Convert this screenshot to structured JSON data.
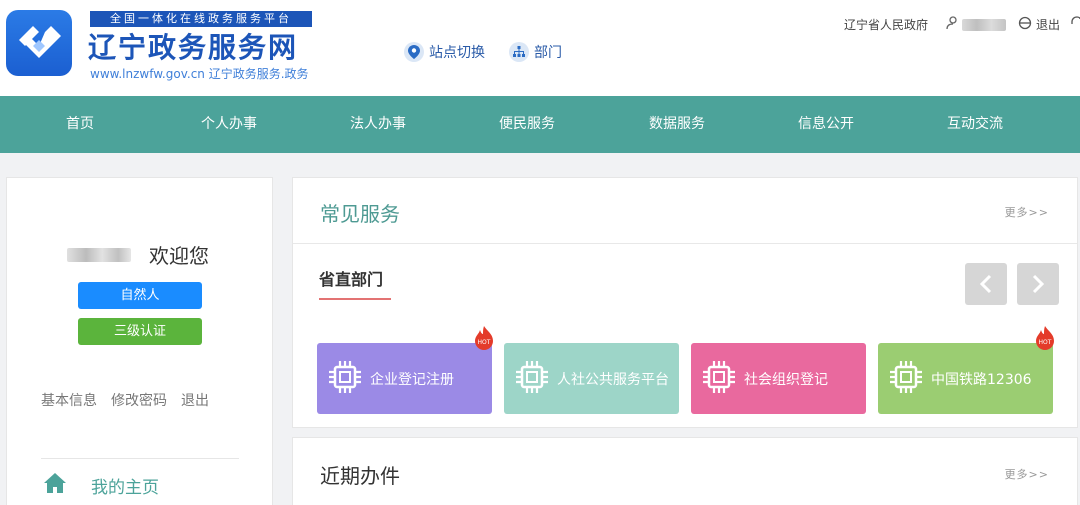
{
  "header": {
    "banner": "全国一体化在线政务服务平台",
    "site_title": "辽宁政务服务网",
    "url_text": "www.lnzwfw.gov.cn  辽宁政务服务.政务",
    "site_switch": "站点切换",
    "department": "部门",
    "province_gov": "辽宁省人民政府",
    "logout": "退出"
  },
  "nav": {
    "items": [
      "首页",
      "个人办事",
      "法人办事",
      "便民服务",
      "数据服务",
      "信息公开",
      "互动交流"
    ]
  },
  "user_panel": {
    "welcome": "欢迎您",
    "badge_type": "自然人",
    "badge_level": "三级认证",
    "links": [
      "基本信息",
      "修改密码",
      "退出"
    ],
    "my_home": "我的主页"
  },
  "common_services": {
    "title": "常见服务",
    "more": "更多>>",
    "subtitle": "省直部门",
    "tiles": [
      {
        "label": "企业登记注册",
        "color": "#9b8ae6",
        "hot": true
      },
      {
        "label": "人社公共服务平台",
        "color": "#9dd5c8",
        "hot": false
      },
      {
        "label": "社会组织登记",
        "color": "#e9699e",
        "hot": false
      },
      {
        "label": "中国铁路12306",
        "color": "#9bcd72",
        "hot": true
      }
    ],
    "hot_badge": "HOT"
  },
  "recent": {
    "title": "近期办件",
    "more": "更多>>"
  },
  "colors": {
    "nav_bg": "#4ca39a",
    "brand_blue": "#1c55b8",
    "badge_blue": "#1a8cff",
    "badge_green": "#5bb43c"
  }
}
